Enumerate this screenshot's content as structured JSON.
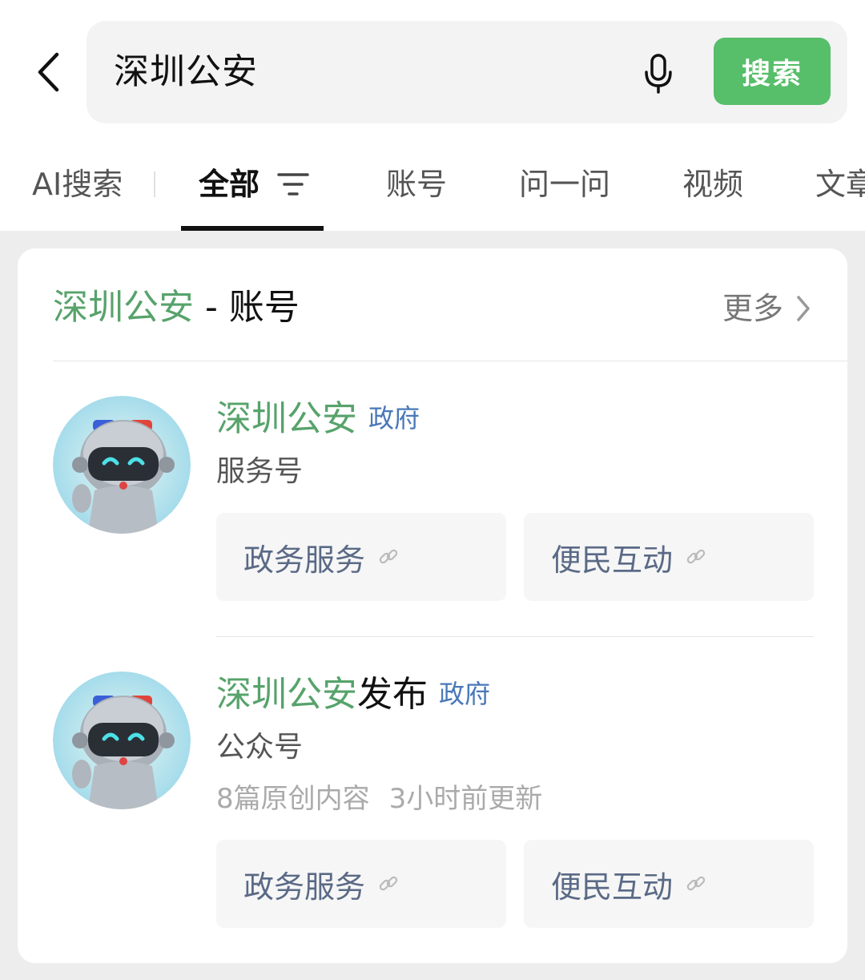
{
  "search": {
    "query": "深圳公安",
    "button_label": "搜索"
  },
  "tabs": [
    {
      "label": "AI搜索"
    },
    {
      "label": "全部"
    },
    {
      "label": "账号"
    },
    {
      "label": "问一问"
    },
    {
      "label": "视频"
    },
    {
      "label": "文章"
    }
  ],
  "section": {
    "title_keyword": "深圳公安",
    "title_suffix": " - 账号",
    "more_label": "更多"
  },
  "accounts": [
    {
      "name_keyword": "深圳公安",
      "name_suffix": "",
      "badge": "政府",
      "type": "服务号",
      "meta": [],
      "menu": [
        {
          "label": "政务服务"
        },
        {
          "label": "便民互动"
        }
      ]
    },
    {
      "name_keyword": "深圳公安",
      "name_suffix": "发布",
      "badge": "政府",
      "type": "公众号",
      "meta": [
        "8篇原创内容",
        "3小时前更新"
      ],
      "menu": [
        {
          "label": "政务服务"
        },
        {
          "label": "便民互动"
        }
      ]
    }
  ],
  "colors": {
    "accent_green": "#57be6a",
    "keyword_green": "#57a36b",
    "badge_blue": "#4a78b8"
  },
  "icons": [
    "back-arrow-icon",
    "microphone-icon",
    "filter-icon",
    "chevron-right-icon",
    "link-icon",
    "robot-avatar"
  ]
}
